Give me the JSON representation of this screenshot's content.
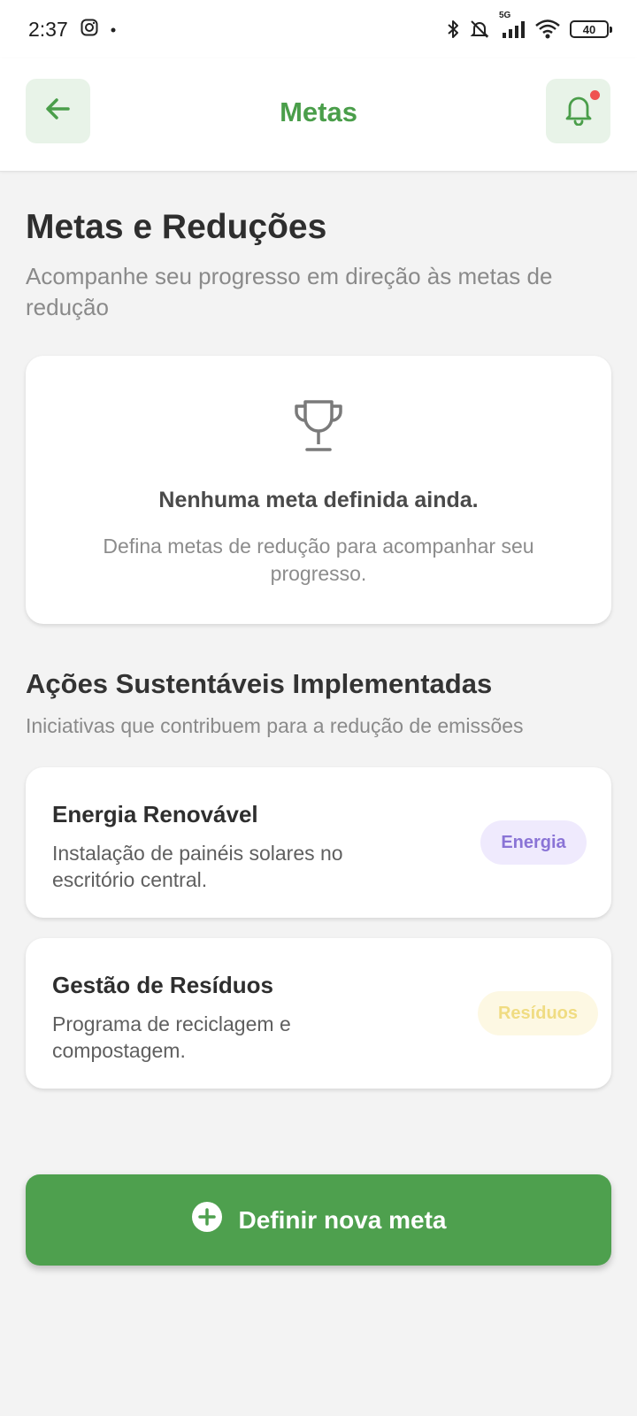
{
  "status_bar": {
    "time": "2:37",
    "network": "5G",
    "battery": "40",
    "icons": [
      "instagram-icon",
      "bluetooth-icon",
      "mute-icon",
      "signal-icon",
      "wifi-icon",
      "battery-icon"
    ]
  },
  "header": {
    "title": "Metas",
    "back_icon": "arrow-left-icon",
    "bell_icon": "bell-icon",
    "has_notification": true
  },
  "page": {
    "title": "Metas e Reduções",
    "subtitle": "Acompanhe seu progresso em direção às metas de redução"
  },
  "empty_state": {
    "icon": "trophy-icon",
    "title": "Nenhuma meta definida ainda.",
    "description": "Defina metas de redução para acompanhar seu progresso."
  },
  "actions_section": {
    "title": "Ações Sustentáveis Implementadas",
    "subtitle": "Iniciativas que contribuem para a redução de emissões",
    "items": [
      {
        "title": "Energia Renovável",
        "description": "Instalação de painéis solares no escritório central.",
        "tag": "Energia"
      },
      {
        "title": "Gestão de Resíduos",
        "description": "Programa de reciclagem e compostagem.",
        "tag": "Resíduos"
      }
    ]
  },
  "primary_button": {
    "label": "Definir nova meta",
    "icon": "plus-circle-icon"
  },
  "colors": {
    "brand_green": "#4ea04e",
    "header_title_green": "#4a9e4a",
    "icon_button_bg": "#e8f3e8",
    "notification_dot": "#ef5350",
    "tag_energia_bg": "#efeafd",
    "tag_energia_text": "#8a74d6",
    "tag_residuos_bg": "#fdf8e3",
    "tag_residuos_text": "#f0dc82"
  }
}
